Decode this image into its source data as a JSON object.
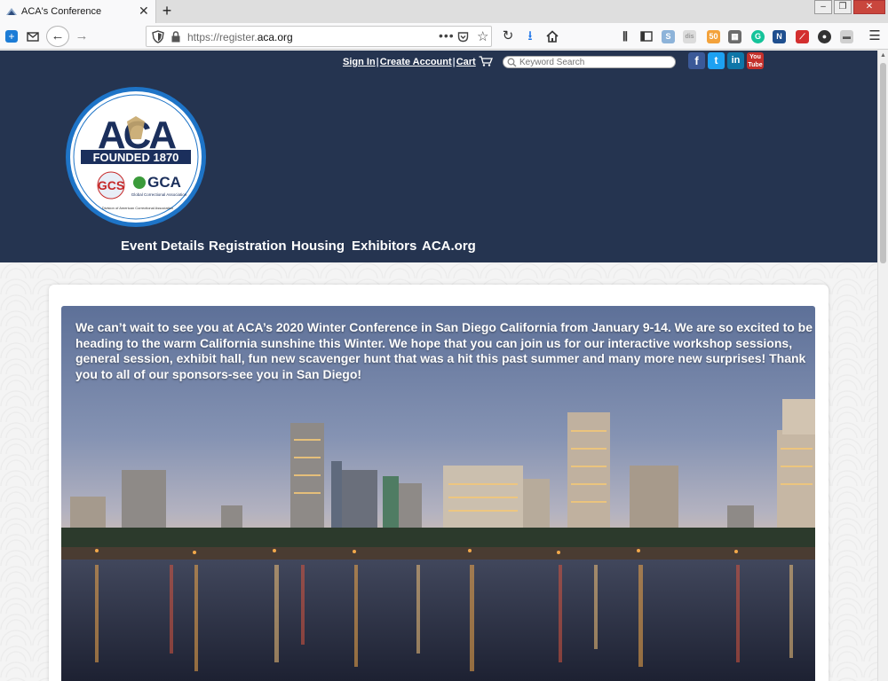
{
  "browser": {
    "tab_title": "ACA's Conference",
    "url_prefix": "https://register.",
    "url_domain": "aca.org"
  },
  "site": {
    "toplinks": {
      "sign_in": "Sign In",
      "create_account": "Create Account",
      "cart": "Cart"
    },
    "search": {
      "placeholder": "Keyword Search"
    },
    "social": [
      "facebook-icon",
      "twitter-icon",
      "linkedin-icon",
      "youtube-icon"
    ],
    "logo": {
      "name": "ACA",
      "tagline": "FOUNDED 1870",
      "gcs": "GCS",
      "gca": "GCA",
      "gca_sub": "Global Correctional Association",
      "ring_text": "Division of American Correctional Association"
    },
    "nav": [
      "Event Details",
      "Registration",
      "Housing",
      "Exhibitors",
      "ACA.org"
    ],
    "hero_text": "We can’t wait to see you at ACA’s 2020 Winter Conference in San Diego California from January 9-14. We are so excited to be heading to the warm California sunshine this Winter. We hope that you can join us for our interactive workshop sessions, general session, exhibit hall, fun new scavenger hunt that was a hit this past summer and many more new surprises! Thank you to all of our sponsors-see you in San Diego!"
  },
  "colors": {
    "header_bg": "#253450",
    "accent_blue": "#1c5aa6"
  }
}
